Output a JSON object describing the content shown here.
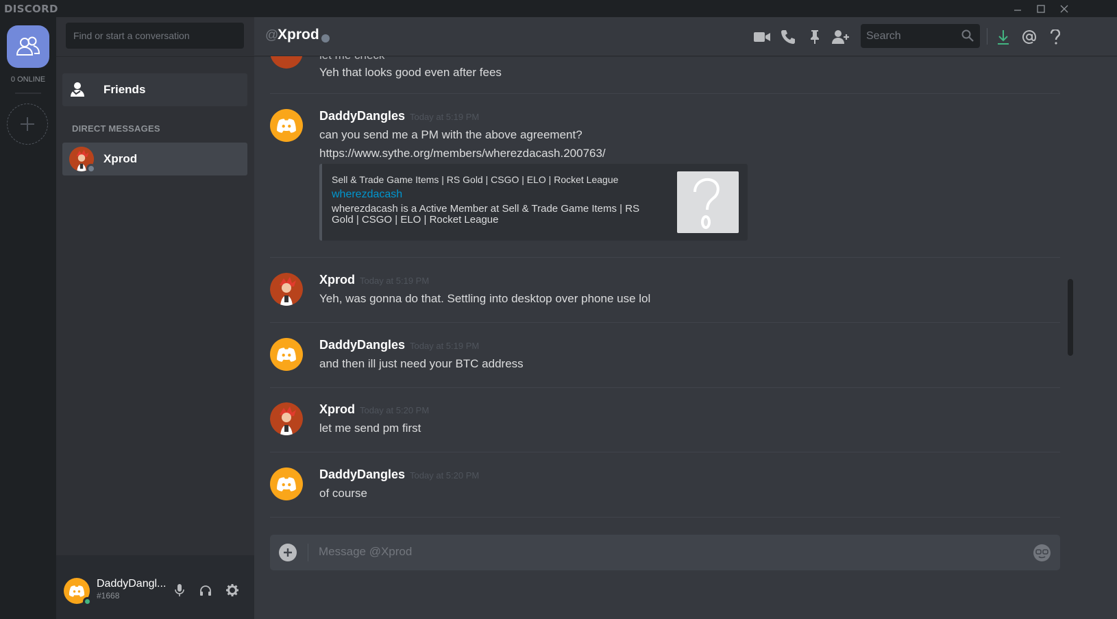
{
  "app": {
    "logo": "DISCORD"
  },
  "servers": {
    "online_label": "0 ONLINE"
  },
  "dm_sidebar": {
    "search_placeholder": "Find or start a conversation",
    "friends_label": "Friends",
    "section_header": "DIRECT MESSAGES",
    "items": [
      {
        "label": "Xprod",
        "status": "offline"
      }
    ]
  },
  "user_panel": {
    "name": "DaddyDangl...",
    "tag": "#1668"
  },
  "channel": {
    "at_symbol": "@",
    "name": "Xprod",
    "search_placeholder": "Search"
  },
  "messages": [
    {
      "text": "let me check",
      "partial": true
    },
    {
      "text": "Yeh that looks good even after fees"
    },
    {
      "author": "DaddyDangles",
      "timestamp": "Today at 5:19 PM",
      "lines": [
        "can you send me a PM with the above agreement?"
      ],
      "link": "https://www.sythe.org/members/wherezdacash.200763/",
      "embed": {
        "provider": "Sell & Trade Game Items | RS Gold | CSGO | ELO | Rocket League",
        "title": "wherezdacash",
        "description": "wherezdacash is a Active Member at Sell & Trade Game Items | RS Gold | CSGO | ELO | Rocket League"
      }
    },
    {
      "author": "Xprod",
      "timestamp": "Today at 5:19 PM",
      "text": "Yeh, was gonna do that.  Settling into desktop over phone use lol"
    },
    {
      "author": "DaddyDangles",
      "timestamp": "Today at 5:19 PM",
      "text": "and then ill just need your BTC address"
    },
    {
      "author": "Xprod",
      "timestamp": "Today at 5:20 PM",
      "text": "let me send pm first"
    },
    {
      "author": "DaddyDangles",
      "timestamp": "Today at 5:20 PM",
      "text": "of course"
    }
  ],
  "composer": {
    "placeholder": "Message @Xprod"
  },
  "colors": {
    "blurple": "#7289da",
    "link": "#0096cf",
    "discord_orange": "#faa61a",
    "download_green": "#43b581"
  },
  "icons": [
    "minimize-icon",
    "maximize-icon",
    "close-icon",
    "friends-icon",
    "add-server-icon",
    "video-call-icon",
    "phone-icon",
    "pin-icon",
    "add-friend-icon",
    "search-icon",
    "download-icon",
    "mention-icon",
    "help-icon",
    "mic-icon",
    "headphones-icon",
    "settings-gear-icon",
    "upload-plus-icon",
    "emoji-icon"
  ]
}
